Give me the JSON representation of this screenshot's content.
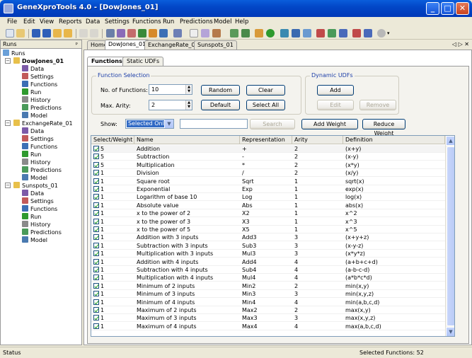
{
  "window": {
    "title": "GeneXproTools 4.0 - [DowJones_01]"
  },
  "menu": [
    "File",
    "Edit",
    "View",
    "Reports",
    "Data",
    "Settings",
    "Functions",
    "Run",
    "Predictions",
    "Model",
    "Help"
  ],
  "runs_panel": {
    "header": "Runs",
    "pin_glyph": "ᵖ",
    "root_label": "Runs",
    "projects": [
      {
        "name": "DowJones_01",
        "items": [
          "Data",
          "Settings",
          "Functions",
          "Run",
          "History",
          "Predictions",
          "Model"
        ]
      },
      {
        "name": "ExchangeRate_01",
        "items": [
          "Data",
          "Settings",
          "Functions",
          "Run",
          "History",
          "Predictions",
          "Model"
        ]
      },
      {
        "name": "Sunspots_01",
        "items": [
          "Data",
          "Settings",
          "Functions",
          "Run",
          "History",
          "Predictions",
          "Model"
        ]
      }
    ]
  },
  "doc_tabs": [
    "Home",
    "DowJones_01",
    "ExchangeRate_01",
    "Sunspots_01"
  ],
  "doc_tab_nav": "◁ ▷ ✕",
  "inner_tabs": [
    "Functions",
    "Static UDFs"
  ],
  "function_selection": {
    "title": "Function Selection",
    "num_functions_label": "No. of Functions:",
    "num_functions_value": "10",
    "max_arity_label": "Max. Arity:",
    "max_arity_value": "2",
    "random_label": "Random",
    "clear_label": "Clear",
    "default_label": "Default",
    "select_all_label": "Select All"
  },
  "dynamic_udfs": {
    "title": "Dynamic UDFs",
    "add_label": "Add",
    "edit_label": "Edit",
    "remove_label": "Remove"
  },
  "filter": {
    "show_label": "Show:",
    "show_value": "Selected Only",
    "search_value": "",
    "search_button": "Search",
    "add_weight": "Add Weight",
    "reduce_weight": "Reduce Weight"
  },
  "table": {
    "columns": [
      "Select/Weight",
      "Name",
      "Representation",
      "Arity",
      "Definition"
    ],
    "rows": [
      [
        "5",
        "Addition",
        "+",
        "2",
        "(x+y)"
      ],
      [
        "5",
        "Subtraction",
        "-",
        "2",
        "(x-y)"
      ],
      [
        "5",
        "Multiplication",
        "*",
        "2",
        "(x*y)"
      ],
      [
        "1",
        "Division",
        "/",
        "2",
        "(x/y)"
      ],
      [
        "1",
        "Square root",
        "Sqrt",
        "1",
        "sqrt(x)"
      ],
      [
        "1",
        "Exponential",
        "Exp",
        "1",
        "exp(x)"
      ],
      [
        "1",
        "Logarithm of base 10",
        "Log",
        "1",
        "log(x)"
      ],
      [
        "1",
        "Absolute value",
        "Abs",
        "1",
        "abs(x)"
      ],
      [
        "1",
        "x to the power of 2",
        "X2",
        "1",
        "x^2"
      ],
      [
        "1",
        "x to the power of 3",
        "X3",
        "1",
        "x^3"
      ],
      [
        "1",
        "x to the power of 5",
        "X5",
        "1",
        "x^5"
      ],
      [
        "1",
        "Addition with 3 inputs",
        "Add3",
        "3",
        "(x+y+z)"
      ],
      [
        "1",
        "Subtraction with 3 inputs",
        "Sub3",
        "3",
        "(x-y-z)"
      ],
      [
        "1",
        "Multiplication with 3 inputs",
        "Mul3",
        "3",
        "(x*y*z)"
      ],
      [
        "1",
        "Addition with 4 inputs",
        "Add4",
        "4",
        "(a+b+c+d)"
      ],
      [
        "1",
        "Subtraction with 4 inputs",
        "Sub4",
        "4",
        "(a-b-c-d)"
      ],
      [
        "1",
        "Multiplication with 4 inputs",
        "Mul4",
        "4",
        "(a*b*c*d)"
      ],
      [
        "1",
        "Minimum of 2 inputs",
        "Min2",
        "2",
        "min(x,y)"
      ],
      [
        "1",
        "Minimum of 3 inputs",
        "Min3",
        "3",
        "min(x,y,z)"
      ],
      [
        "1",
        "Minimum of 4 inputs",
        "Min4",
        "4",
        "min(a,b,c,d)"
      ],
      [
        "1",
        "Maximum of 2 inputs",
        "Max2",
        "2",
        "max(x,y)"
      ],
      [
        "1",
        "Maximum of 3 inputs",
        "Max3",
        "3",
        "max(x,y,z)"
      ],
      [
        "1",
        "Maximum of 4 inputs",
        "Max4",
        "4",
        "max(a,b,c,d)"
      ]
    ]
  },
  "status": {
    "left": "Status",
    "right": "Selected Functions: 52"
  },
  "colors": {
    "title_bar": "#0247c7",
    "accent": "#316ac5",
    "group_title": "#1c3ea8"
  }
}
